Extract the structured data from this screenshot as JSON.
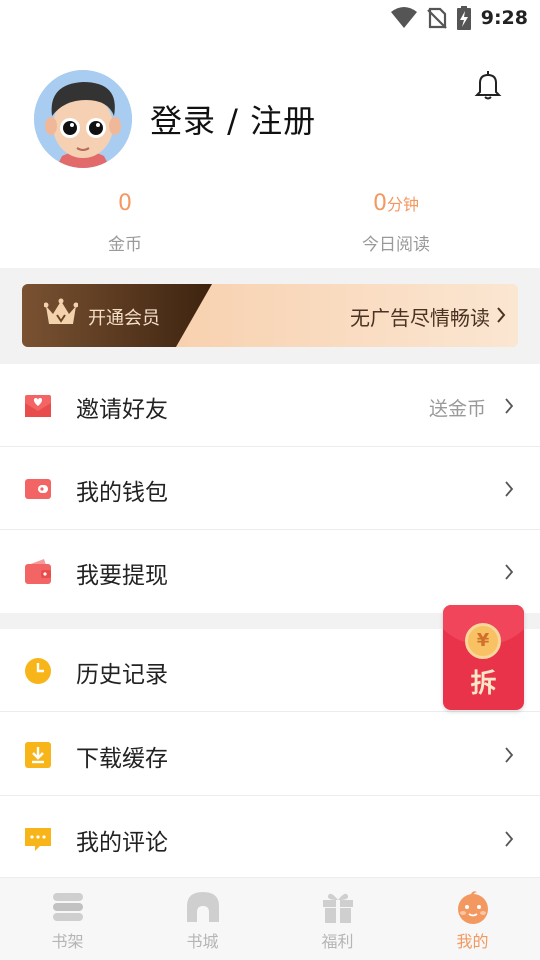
{
  "status_bar": {
    "time": "9:28"
  },
  "profile": {
    "login_label": "登录 / 注册"
  },
  "stats": [
    {
      "value": "0",
      "unit": "",
      "label": "金币"
    },
    {
      "value": "0",
      "unit": "分钟",
      "label": "今日阅读"
    }
  ],
  "vip_banner": {
    "open_label": "开通会员",
    "promo_text": "无广告尽情畅读"
  },
  "menu_group_1": [
    {
      "label": "邀请好友",
      "extra": "送金币",
      "icon": "invite-envelope-icon"
    },
    {
      "label": "我的钱包",
      "extra": "",
      "icon": "wallet-icon"
    },
    {
      "label": "我要提现",
      "extra": "",
      "icon": "withdraw-wallet-icon"
    }
  ],
  "menu_group_2": [
    {
      "label": "历史记录",
      "extra": "",
      "icon": "clock-icon"
    },
    {
      "label": "下载缓存",
      "extra": "",
      "icon": "download-icon"
    },
    {
      "label": "我的评论",
      "extra": "",
      "icon": "comment-icon"
    }
  ],
  "red_packet": {
    "coin_symbol": "¥",
    "label": "拆"
  },
  "tabs": [
    {
      "label": "书架",
      "icon": "bookshelf-icon"
    },
    {
      "label": "书城",
      "icon": "bookstore-icon"
    },
    {
      "label": "福利",
      "icon": "gift-icon"
    },
    {
      "label": "我的",
      "icon": "profile-face-icon"
    }
  ],
  "colors": {
    "accent": "#f39860",
    "red_packet": "#e8334a",
    "vip_dark": "#5a3a20",
    "vip_light": "#f8d6b6"
  }
}
